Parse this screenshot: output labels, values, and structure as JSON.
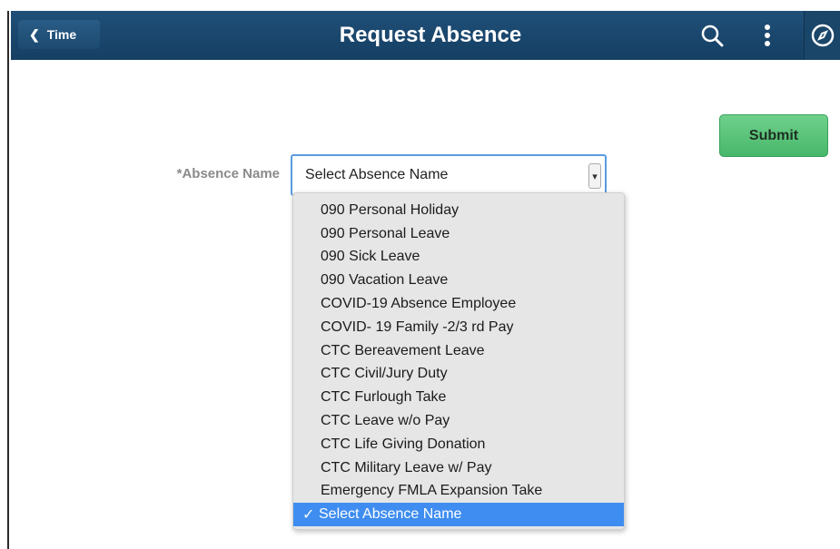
{
  "header": {
    "back_label": "Time",
    "back_icon": "chevron-left-icon",
    "title": "Request Absence",
    "icons": [
      "search-icon",
      "more-vertical-icon",
      "navigator-icon"
    ],
    "bg_color": "#1f4f78"
  },
  "form": {
    "absence_label": "*Absence Name",
    "select_value": "Select Absence Name",
    "submit_label": "Submit",
    "submit_color": "#4fbe72",
    "focus_color": "#5a9be0"
  },
  "dropdown": {
    "options": [
      "090 Personal Holiday",
      "090 Personal Leave",
      "090 Sick Leave",
      "090 Vacation Leave",
      "COVID-19 Absence Employee",
      "COVID- 19 Family -2/3 rd Pay",
      "CTC Bereavement Leave",
      "CTC Civil/Jury Duty",
      "CTC Furlough Take",
      "CTC Leave w/o Pay",
      "CTC Life Giving Donation",
      "CTC Military Leave w/ Pay",
      "Emergency FMLA Expansion Take",
      "Select Absence Name"
    ],
    "selected_index": 13,
    "check_glyph": "✓",
    "highlight_color": "#3f8df0"
  }
}
